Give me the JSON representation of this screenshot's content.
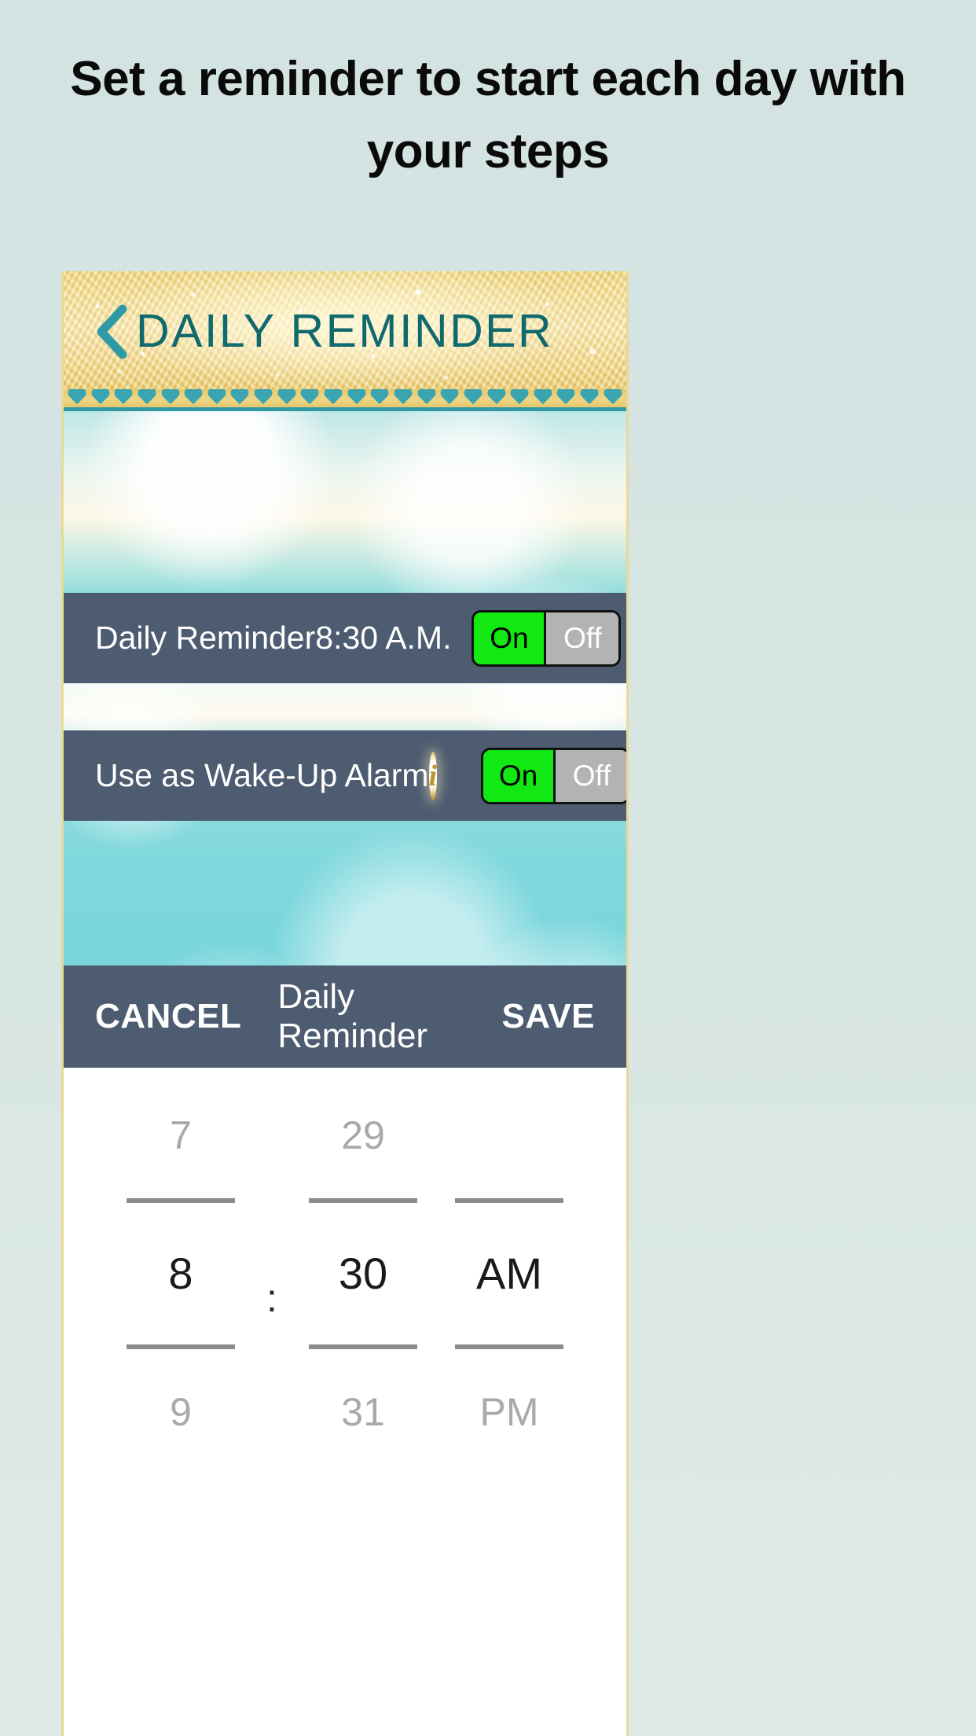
{
  "promo": {
    "heading": "Set a reminder to start each day with your steps"
  },
  "app": {
    "appbar": {
      "back_icon": "chevron-left-icon",
      "title": "DAILY REMINDER",
      "title_color": "#10696d"
    },
    "settings": [
      {
        "label": "Daily Reminder",
        "time": "8:30 A.M.",
        "toggle": {
          "on_label": "On",
          "off_label": "Off",
          "state": "On"
        }
      },
      {
        "label": "Use as Wake-Up Alarm",
        "info_icon": "info-circle-icon",
        "toggle": {
          "on_label": "On",
          "off_label": "Off",
          "state": "On"
        }
      }
    ],
    "dialog": {
      "cancel_label": "CANCEL",
      "title": "Daily Reminder",
      "save_label": "SAVE"
    },
    "time_picker": {
      "hour": {
        "previous": "7",
        "selected": "8",
        "next": "9"
      },
      "minute": {
        "previous": "29",
        "selected": "30",
        "next": "31"
      },
      "meridiem": {
        "previous": "",
        "selected": "AM",
        "next": "PM"
      },
      "separator": ":"
    },
    "colors": {
      "row_background": "#4d5c70",
      "toggle_on": "#12e812",
      "toggle_off": "#b3b3b3",
      "accent_teal": "#2f9aa6",
      "gold": "#e9c96c"
    }
  }
}
